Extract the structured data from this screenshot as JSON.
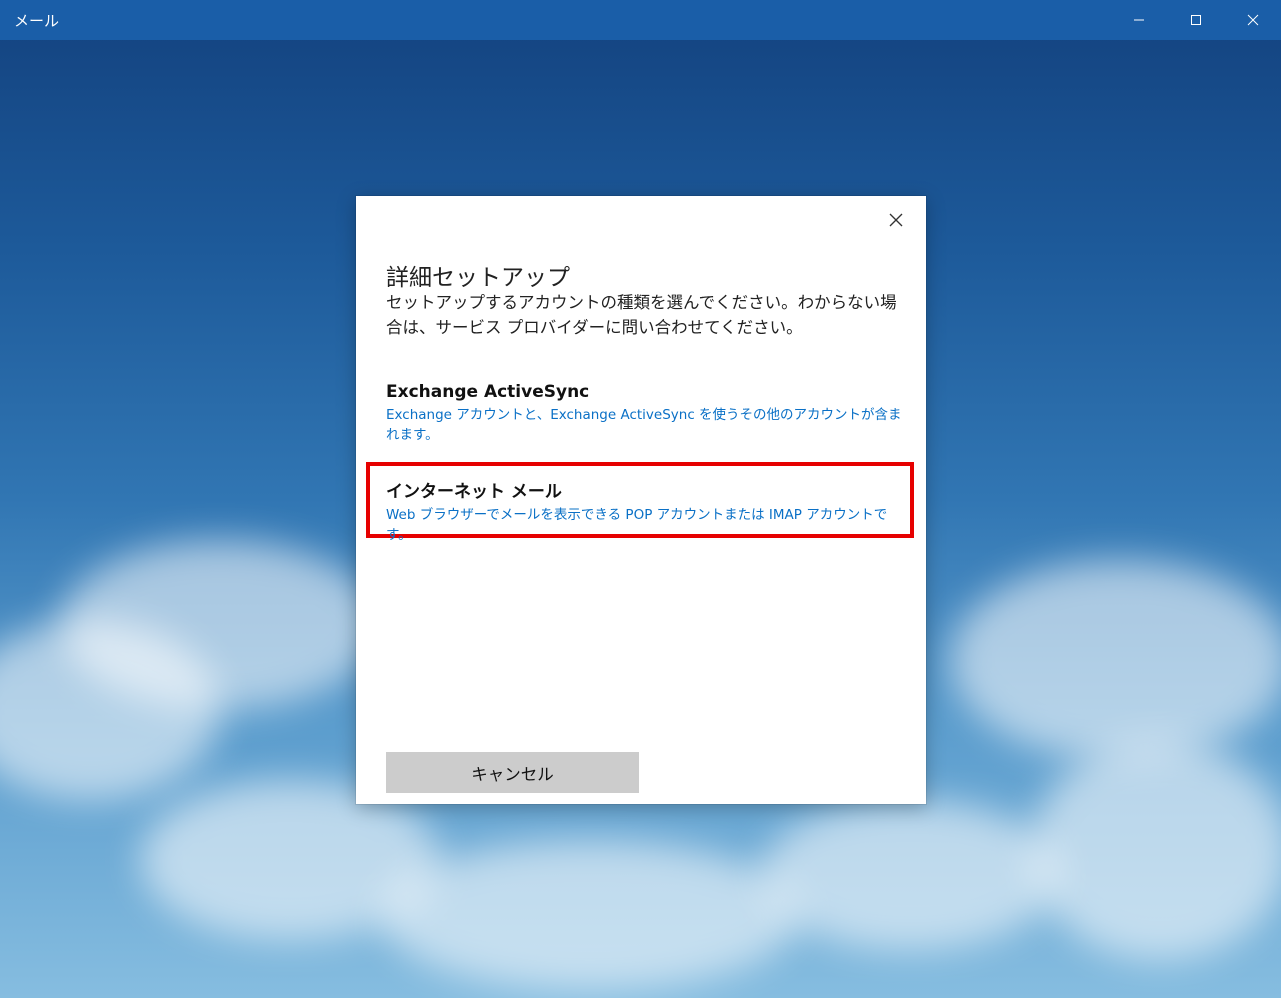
{
  "window": {
    "title": "メール"
  },
  "dialog": {
    "title": "詳細セットアップ",
    "description": "セットアップするアカウントの種類を選んでください。わからない場合は、サービス プロバイダーに問い合わせてください。",
    "options": [
      {
        "title": "Exchange ActiveSync",
        "description": "Exchange アカウントと、Exchange ActiveSync を使うその他のアカウントが含まれます。"
      },
      {
        "title": "インターネット メール",
        "description": "Web ブラウザーでメールを表示できる POP アカウントまたは IMAP アカウントです。",
        "highlighted": true
      }
    ],
    "cancel_label": "キャンセル"
  },
  "colors": {
    "titlebar": "#1a5ea8",
    "link_blue": "#0a70c6",
    "highlight_red": "#e60000",
    "button_gray": "#cccccc"
  },
  "icons": [
    "minimize-icon",
    "maximize-icon",
    "close-icon",
    "dialog-close-icon"
  ]
}
